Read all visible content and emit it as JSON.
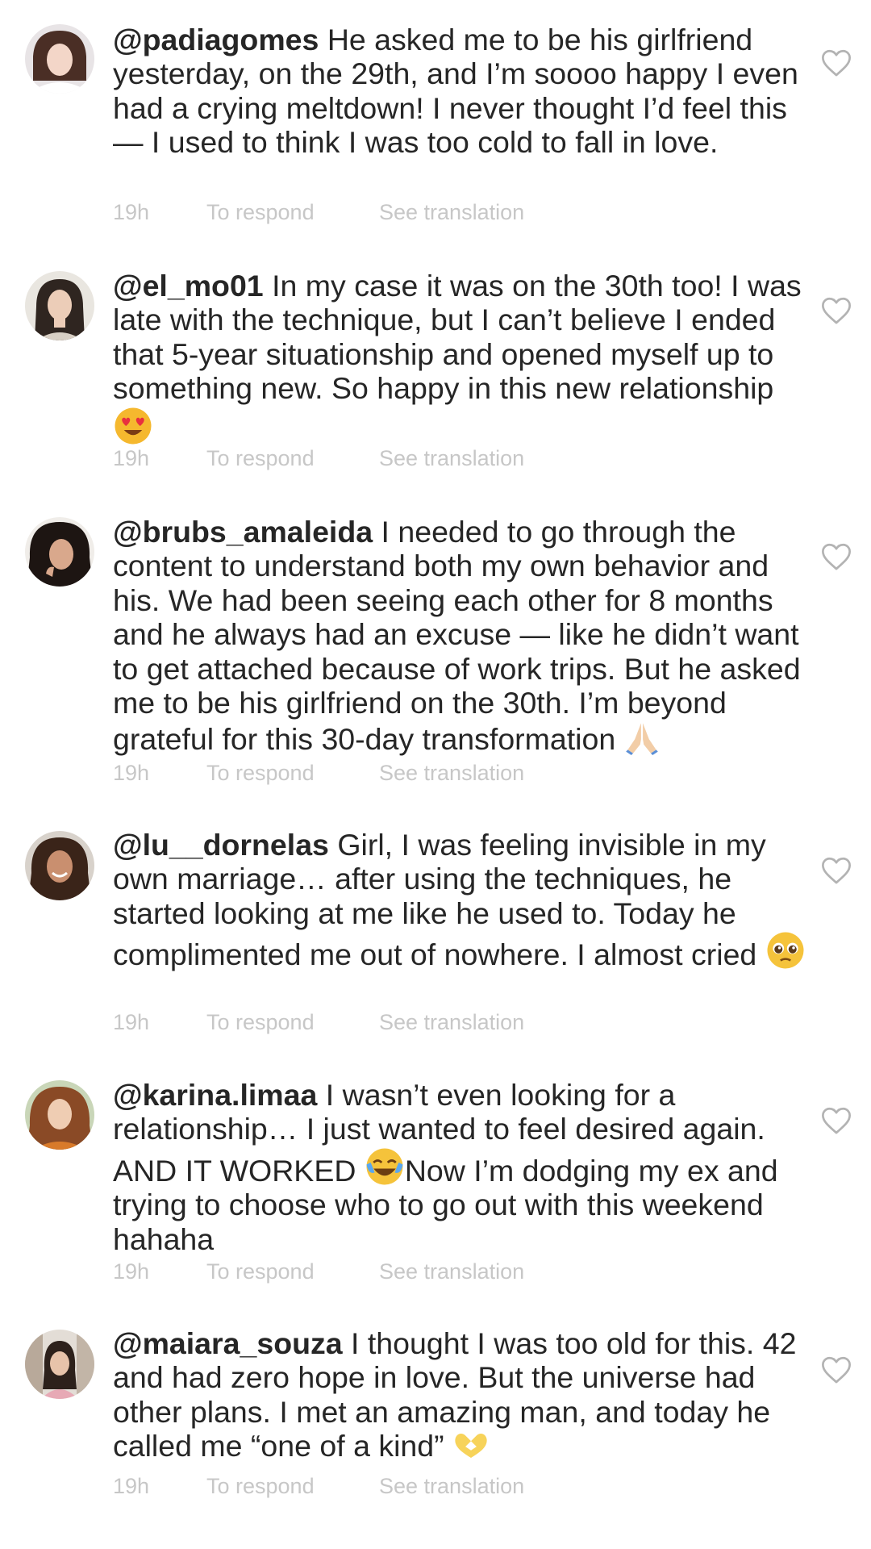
{
  "comments": [
    {
      "username": "@padiagomes",
      "text": "He asked me to be his girlfriend yesterday, on the 29th, and I’m soooo happy I even had a crying meltdown! I never thought I’d feel this — I used to think I was too cold to fall in love.",
      "time": "19h",
      "reply_label": "To respond",
      "translate_label": "See translation"
    },
    {
      "username": "@el_mo01",
      "text": "In my case it was on the 30th too! I was late with the technique, but I can’t believe I ended that 5-year situationship and opened myself up to something new. So happy in this new relationship",
      "emoji": "smiling-face-with-heart-eyes",
      "time": "19h",
      "reply_label": "To respond",
      "translate_label": "See translation"
    },
    {
      "username": "@brubs_amaleida",
      "text": "I needed to go through the content to understand both my own behavior and his. We had been seeing each other for 8 months and he always had an excuse — like he didn’t want to get attached because of work trips. But he asked me to be his girlfriend on the 30th. I’m beyond grateful for this 30-day transformation",
      "emoji": "folded-hands",
      "time": "19h",
      "reply_label": "To respond",
      "translate_label": "See translation"
    },
    {
      "username": "@lu__dornelas",
      "text": "Girl, I was feeling invisible in my own marriage… after using the techniques, he started looking at me like he used to. Today he complimented me out of nowhere. I almost cried",
      "emoji": "pleading-face",
      "time": "19h",
      "reply_label": "To respond",
      "translate_label": "See translation"
    },
    {
      "username": "@karina.limaa",
      "text_before_emoji": "I wasn’t even looking for a relationship… I just wanted to feel desired again. AND IT WORKED",
      "emoji": "face-with-tears-of-joy",
      "text_after_emoji": "Now I’m dodging my ex and trying to choose who to go out with this weekend hahaha",
      "time": "19h",
      "reply_label": "To respond",
      "translate_label": "See translation"
    },
    {
      "username": "@maiara_souza",
      "text": "I thought I was too old for this. 42 and had zero hope in love. But the universe had other plans. I met an amazing man, and today he called me “one of a kind”",
      "emoji": "heart-hands",
      "time": "19h",
      "reply_label": "To respond",
      "translate_label": "See translation"
    }
  ],
  "icons": {
    "like": "heart-outline-icon",
    "avatar": "user-avatar"
  },
  "colors": {
    "text": "#262626",
    "meta": "#c7c7c7",
    "heart": "#b3b3b3"
  }
}
